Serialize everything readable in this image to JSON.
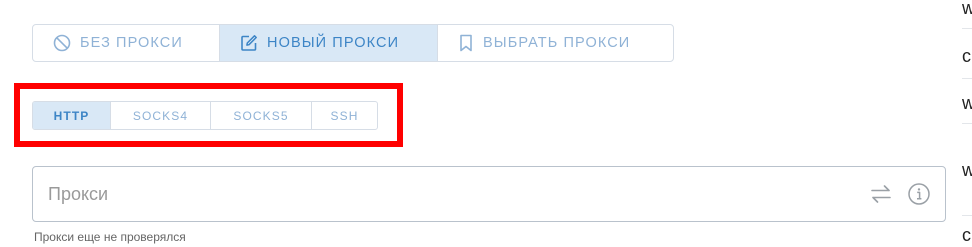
{
  "proxy_modes": [
    {
      "label": "БЕЗ ПРОКСИ",
      "icon": "no-proxy-icon",
      "active": false
    },
    {
      "label": "НОВЫЙ ПРОКСИ",
      "icon": "edit-icon",
      "active": true
    },
    {
      "label": "ВЫБРАТЬ ПРОКСИ",
      "icon": "bookmark-icon",
      "active": false
    }
  ],
  "protocols": [
    {
      "label": "HTTP",
      "active": true
    },
    {
      "label": "SOCKS4",
      "active": false
    },
    {
      "label": "SOCKS5",
      "active": false
    },
    {
      "label": "SSH",
      "active": false
    }
  ],
  "proxy_input": {
    "placeholder": "Прокси",
    "value": "",
    "status": "Прокси еще не проверялся",
    "swap_icon": "swap-arrows-icon",
    "info_icon": "info-icon"
  },
  "side_column": {
    "items": [
      "w",
      "c",
      "w",
      "w",
      "c"
    ]
  },
  "colors": {
    "accent": "#3d85c6",
    "accent_light": "#8fb2d6",
    "active_bg": "#d9e8f6",
    "highlight": "#ff0000",
    "border": "#d6dde6"
  }
}
